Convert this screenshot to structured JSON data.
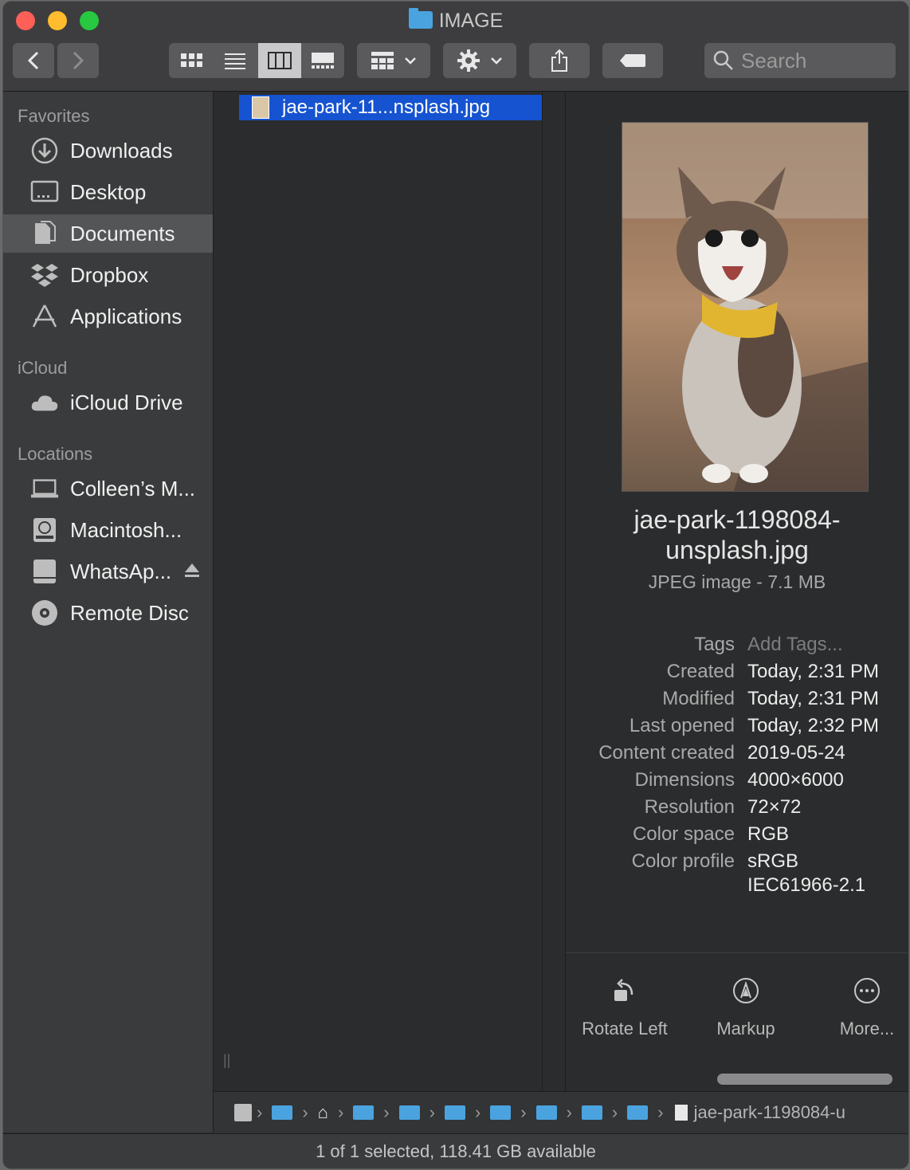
{
  "window": {
    "title": "IMAGE"
  },
  "toolbar": {
    "search_placeholder": "Search"
  },
  "sidebar": {
    "favorites_label": "Favorites",
    "favorites": [
      {
        "label": "Downloads",
        "icon": "download-icon"
      },
      {
        "label": "Desktop",
        "icon": "desktop-icon"
      },
      {
        "label": "Documents",
        "icon": "documents-icon"
      },
      {
        "label": "Dropbox",
        "icon": "dropbox-icon"
      },
      {
        "label": "Applications",
        "icon": "applications-icon"
      }
    ],
    "icloud_label": "iCloud",
    "icloud": [
      {
        "label": "iCloud Drive",
        "icon": "cloud-icon"
      }
    ],
    "locations_label": "Locations",
    "locations": [
      {
        "label": "Colleen’s M...",
        "icon": "laptop-icon"
      },
      {
        "label": "Macintosh...",
        "icon": "harddisk-icon"
      },
      {
        "label": "WhatsAp...",
        "icon": "volume-icon"
      },
      {
        "label": "Remote Disc",
        "icon": "disc-icon"
      }
    ]
  },
  "column": {
    "selected_file": "jae-park-11...nsplash.jpg"
  },
  "preview": {
    "name_line1": "jae-park-1198084-",
    "name_line2": "unsplash.jpg",
    "kind": "JPEG image - 7.1 MB",
    "meta": [
      {
        "key": "Tags",
        "value": "Add Tags..."
      },
      {
        "key": "Created",
        "value": "Today, 2:31 PM"
      },
      {
        "key": "Modified",
        "value": "Today, 2:31 PM"
      },
      {
        "key": "Last opened",
        "value": "Today, 2:32 PM"
      },
      {
        "key": "Content created",
        "value": "2019-05-24"
      },
      {
        "key": "Dimensions",
        "value": "4000×6000"
      },
      {
        "key": "Resolution",
        "value": "72×72"
      },
      {
        "key": "Color space",
        "value": "RGB"
      },
      {
        "key": "Color profile",
        "value": "sRGB"
      },
      {
        "key": "",
        "value": "IEC61966-2.1"
      }
    ],
    "actions": [
      {
        "label": "Rotate Left",
        "icon": "rotate-left-icon"
      },
      {
        "label": "Markup",
        "icon": "markup-icon"
      },
      {
        "label": "More...",
        "icon": "more-icon"
      }
    ]
  },
  "pathbar": {
    "last": "jae-park-1198084-u"
  },
  "status": {
    "text": "1 of 1 selected, 118.41 GB available"
  },
  "colors": {
    "selection": "#1553d1",
    "folder": "#4aa3df",
    "close": "#fe5f57",
    "minimize": "#febc2e",
    "zoom": "#28c840"
  }
}
